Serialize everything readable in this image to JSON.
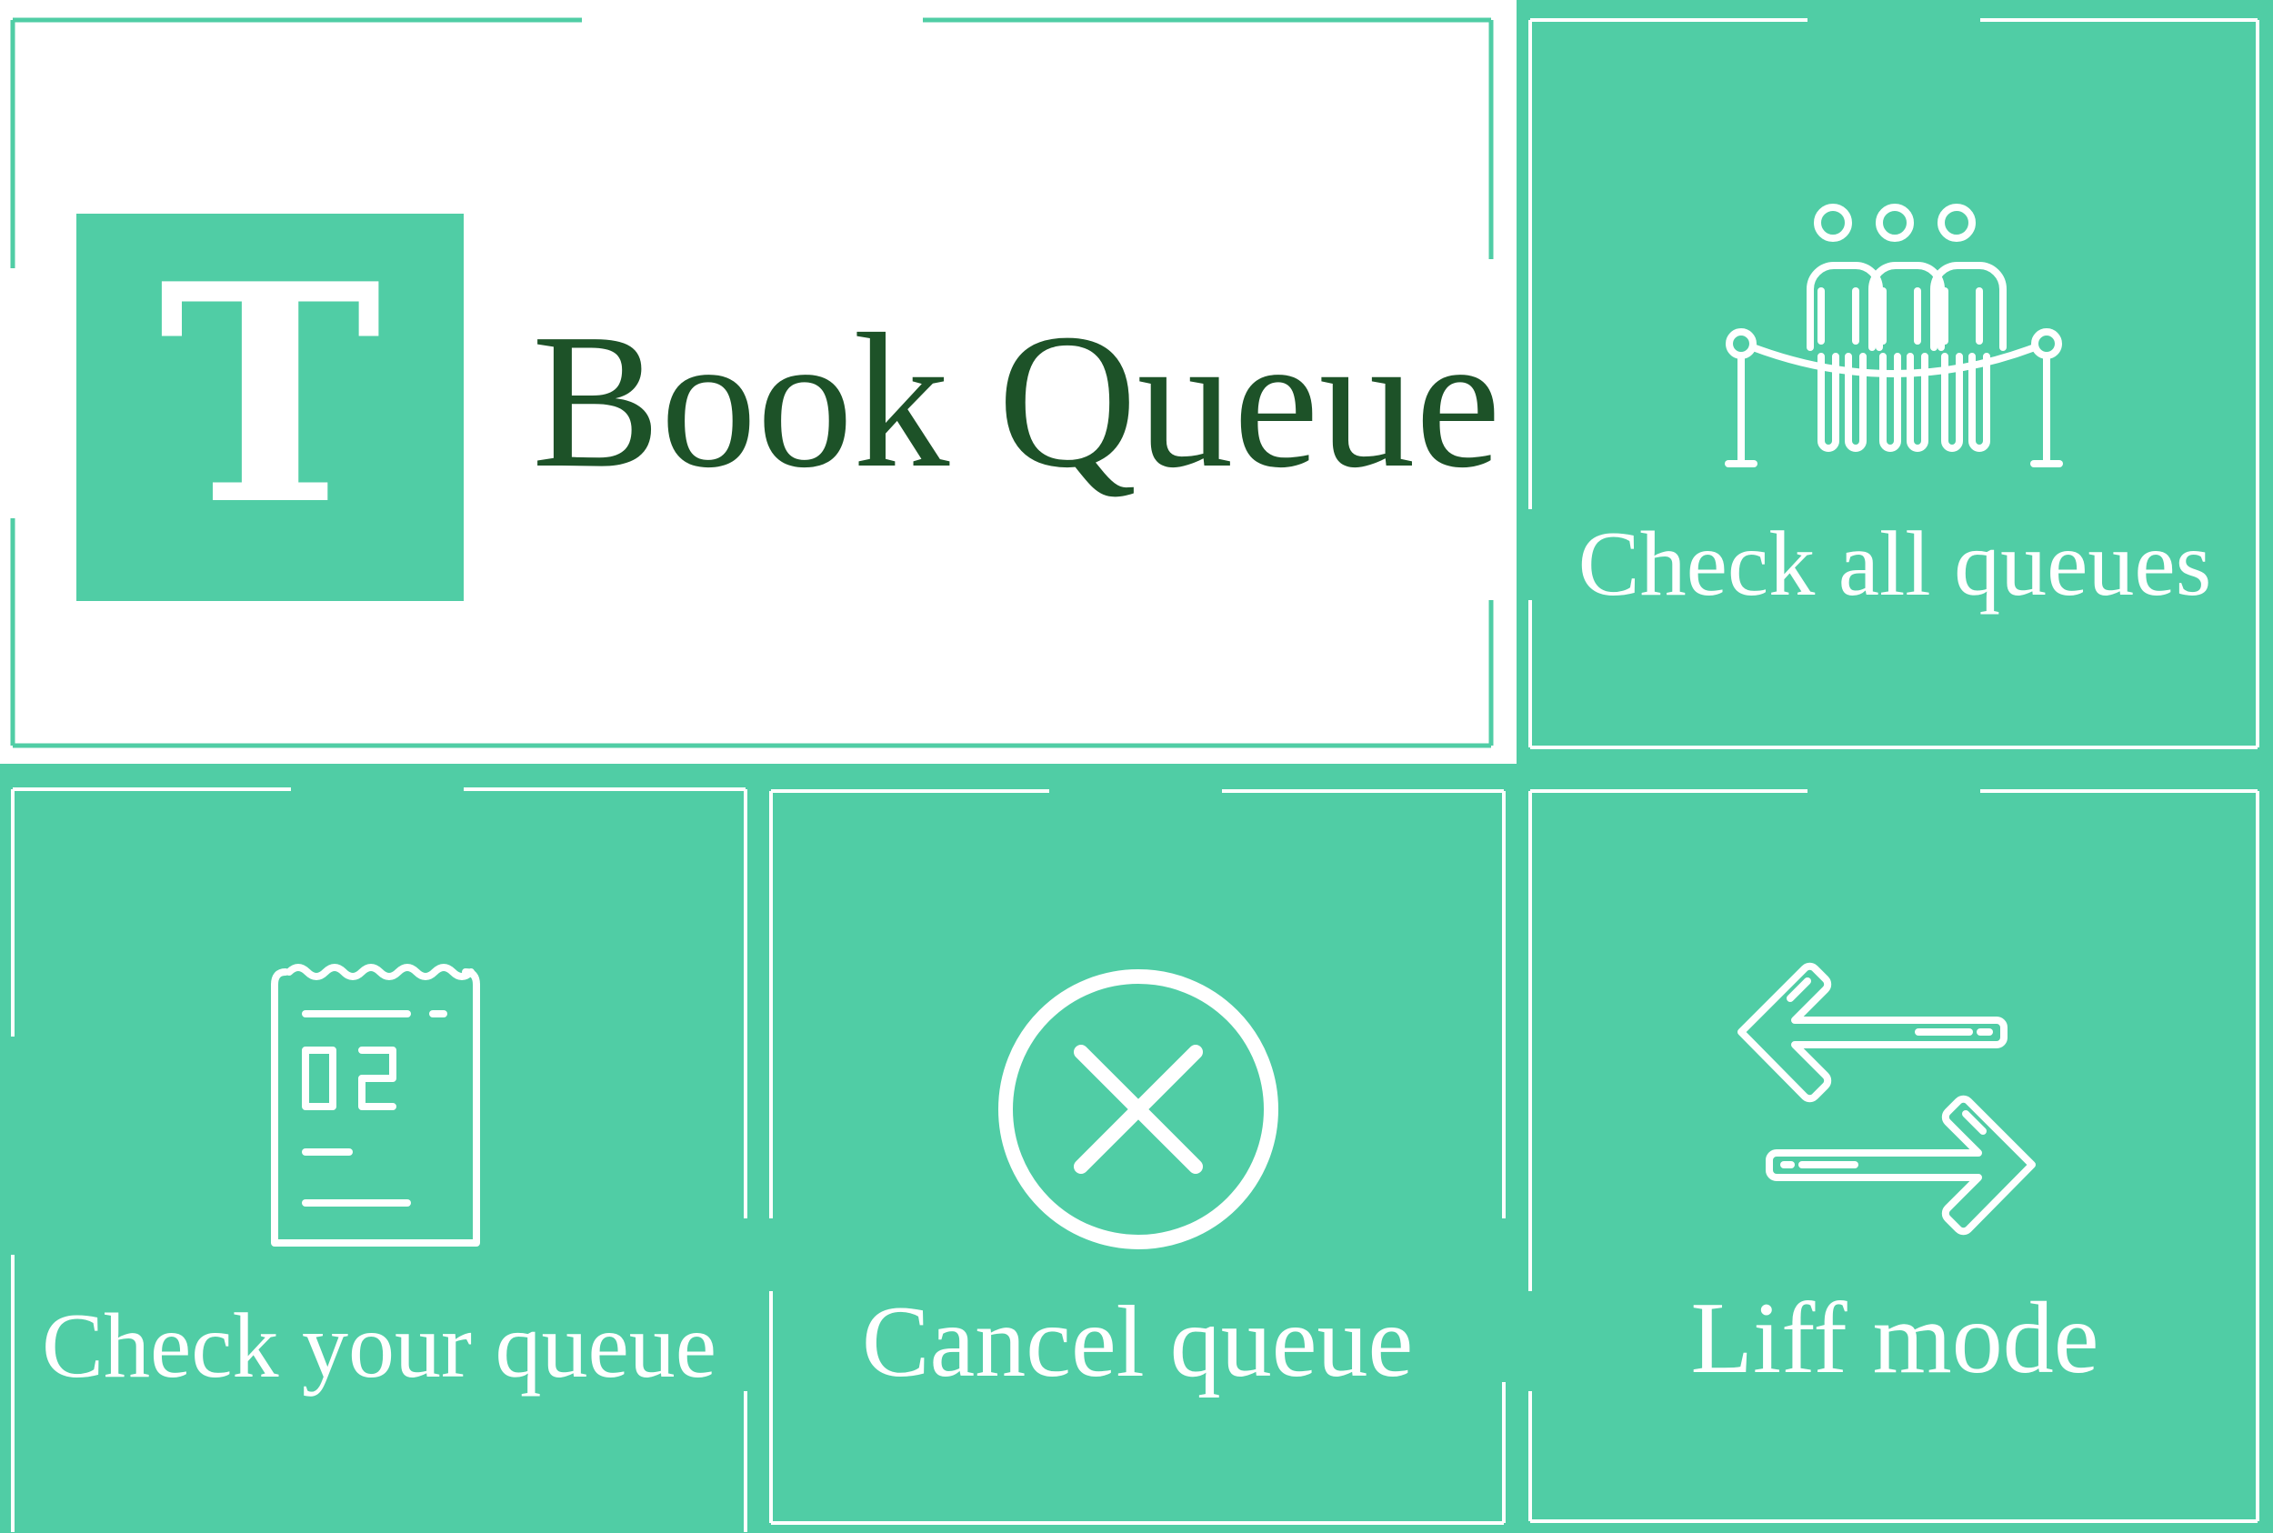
{
  "colors": {
    "accent": "#50cda5",
    "background": "#ffffff",
    "brand_text": "#1d5228",
    "label_text": "#ffffff"
  },
  "brand": {
    "logo_letter": "T",
    "title": "Book Queue"
  },
  "menu": {
    "check_all": {
      "label": "Check all queues",
      "icon": "people-queue-icon"
    },
    "check_yours": {
      "label": "Check your queue",
      "icon": "queue-ticket-icon"
    },
    "cancel": {
      "label": "Cancel queue",
      "icon": "cancel-circle-icon"
    },
    "liff": {
      "label": "Liff mode",
      "icon": "switch-arrows-icon"
    }
  }
}
